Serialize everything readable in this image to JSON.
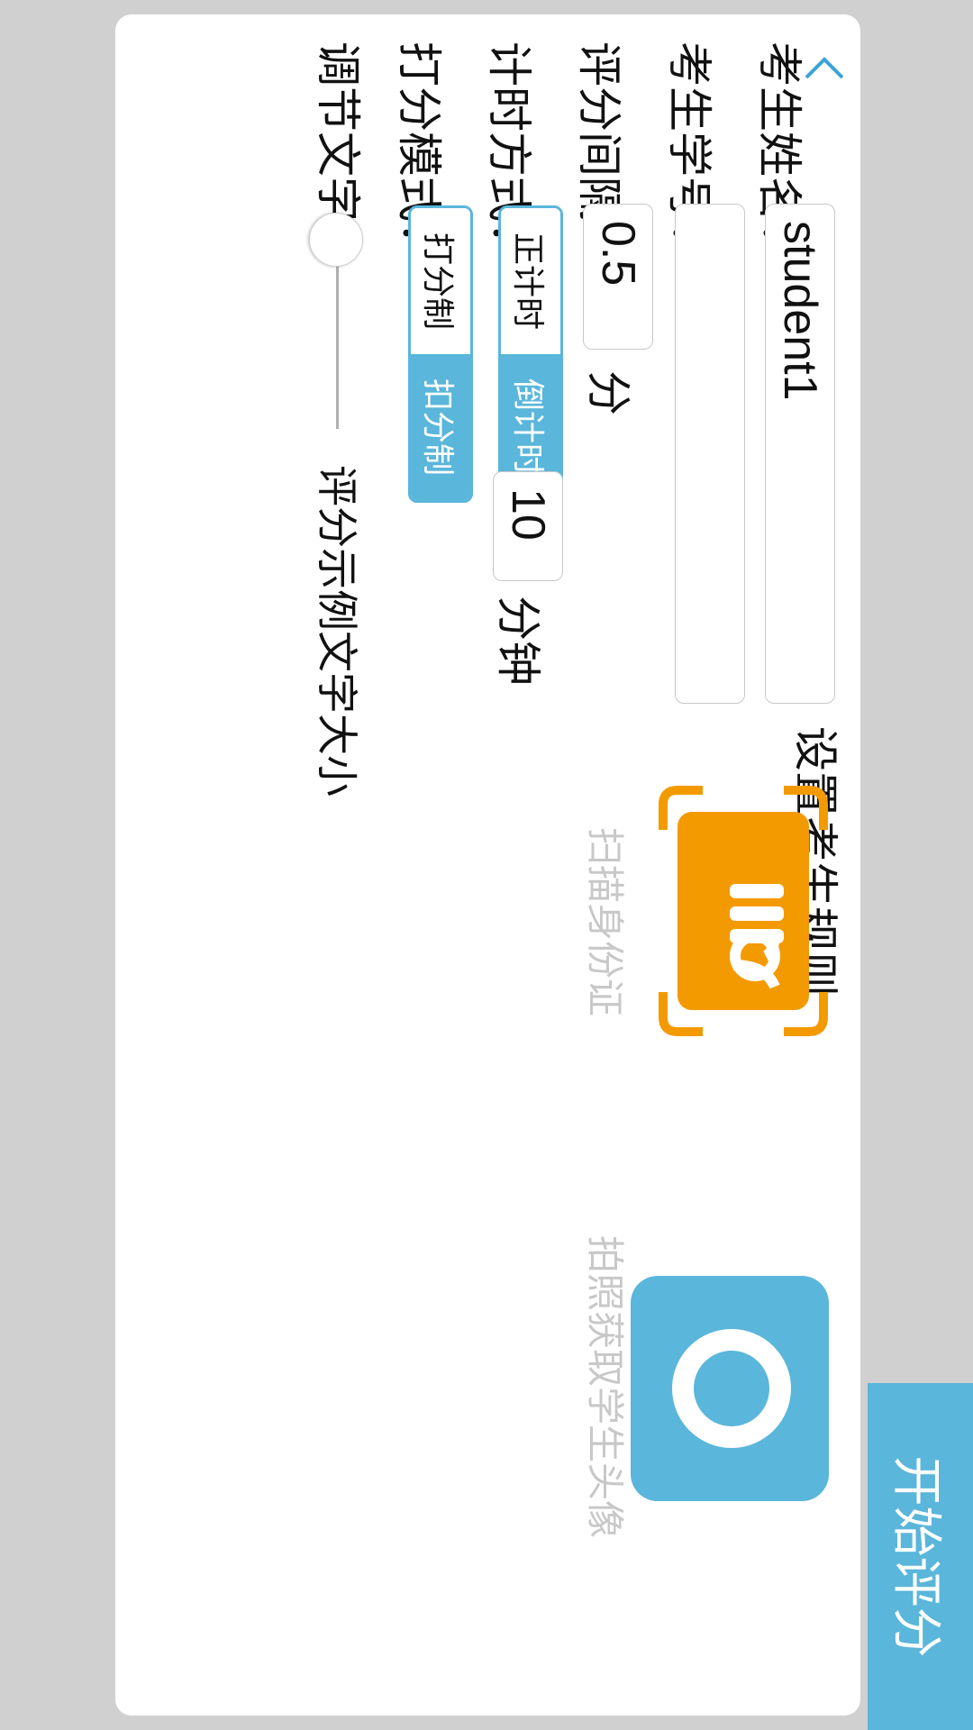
{
  "header": {
    "title": "设置考生规则"
  },
  "form": {
    "name_label": "考生姓名：",
    "name_value": "student1",
    "id_label": "考生学号：",
    "id_value": "",
    "interval_label": "评分间隔：",
    "interval_value": "0.5",
    "interval_unit": "分",
    "timer_label": "计时方式：",
    "timer_options": [
      "正计时",
      "倒计时"
    ],
    "timer_selected": "倒计时",
    "timer_value": "10",
    "timer_unit": "分钟",
    "mode_label": "打分模式：",
    "mode_options": [
      "打分制",
      "扣分制"
    ],
    "mode_selected": "扣分制",
    "font_label": "调节文字：",
    "font_sample": "评分示例文字大小"
  },
  "actions": {
    "scan_id_caption": "扫描身份证",
    "photo_caption": "拍照获取学生头像",
    "start_button": "开始评分"
  },
  "colors": {
    "accent": "#5ab6da",
    "scan": "#f39a00",
    "background": "#d0d0d0"
  },
  "icons": {
    "back": "chevron-left-icon",
    "scan": "id-card-scan-icon",
    "photo": "camera-icon"
  }
}
